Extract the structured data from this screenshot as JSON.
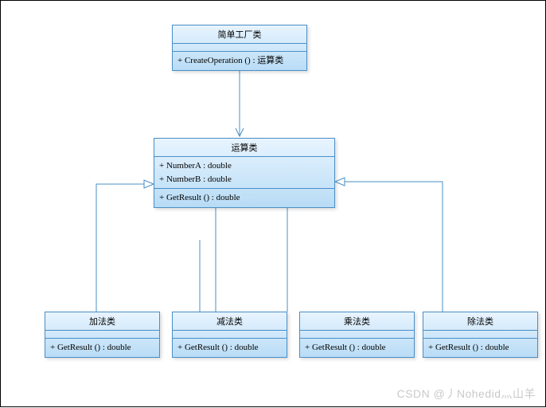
{
  "diagram": {
    "factory": {
      "title": "简单工厂类",
      "method": "+ CreateOperation () : 运算类"
    },
    "operation": {
      "title": "运算类",
      "attr1": "+ NumberA : double",
      "attr2": "+ NumberB : double",
      "method": "+ GetResult () : double"
    },
    "add": {
      "title": "加法类",
      "method": "+ GetResult () : double"
    },
    "sub": {
      "title": "减法类",
      "method": "+ GetResult () : double"
    },
    "mul": {
      "title": "乘法类",
      "method": "+ GetResult () : double"
    },
    "div": {
      "title": "除法类",
      "method": "+ GetResult () : double"
    }
  },
  "watermark": "CSDN @丿Nohedid灬山羊",
  "colors": {
    "stroke": "#4a8fc7",
    "fill_light": "#e8f4ff",
    "fill_dark": "#b8dcf5"
  }
}
